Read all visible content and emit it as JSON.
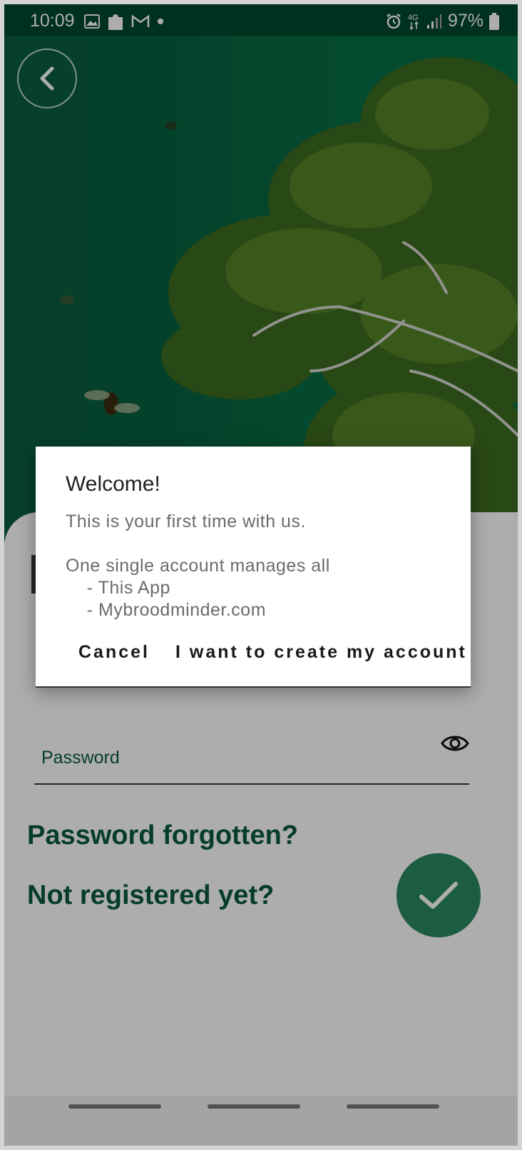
{
  "status_bar": {
    "time": "10:09",
    "battery": "97%",
    "left_icons": [
      "image-icon",
      "puzzle-icon",
      "gmail-icon",
      "dot-icon"
    ],
    "right_icons": [
      "alarm-icon",
      "4g-icon",
      "signal-icon",
      "battery-icon"
    ]
  },
  "login": {
    "password_label": "Password",
    "forgot_link": "Password forgotten?",
    "register_link": "Not registered yet?"
  },
  "dialog": {
    "title": "Welcome!",
    "body": "This is your first time with us.\n\nOne single account manages all\n    - This App\n    - Mybroodminder.com",
    "cancel_label": "Cancel",
    "create_label": "I want to create my account"
  },
  "colors": {
    "brand_green": "#0a5a3a",
    "hero_green": "#066c44",
    "fab_green": "#2a8a61"
  }
}
